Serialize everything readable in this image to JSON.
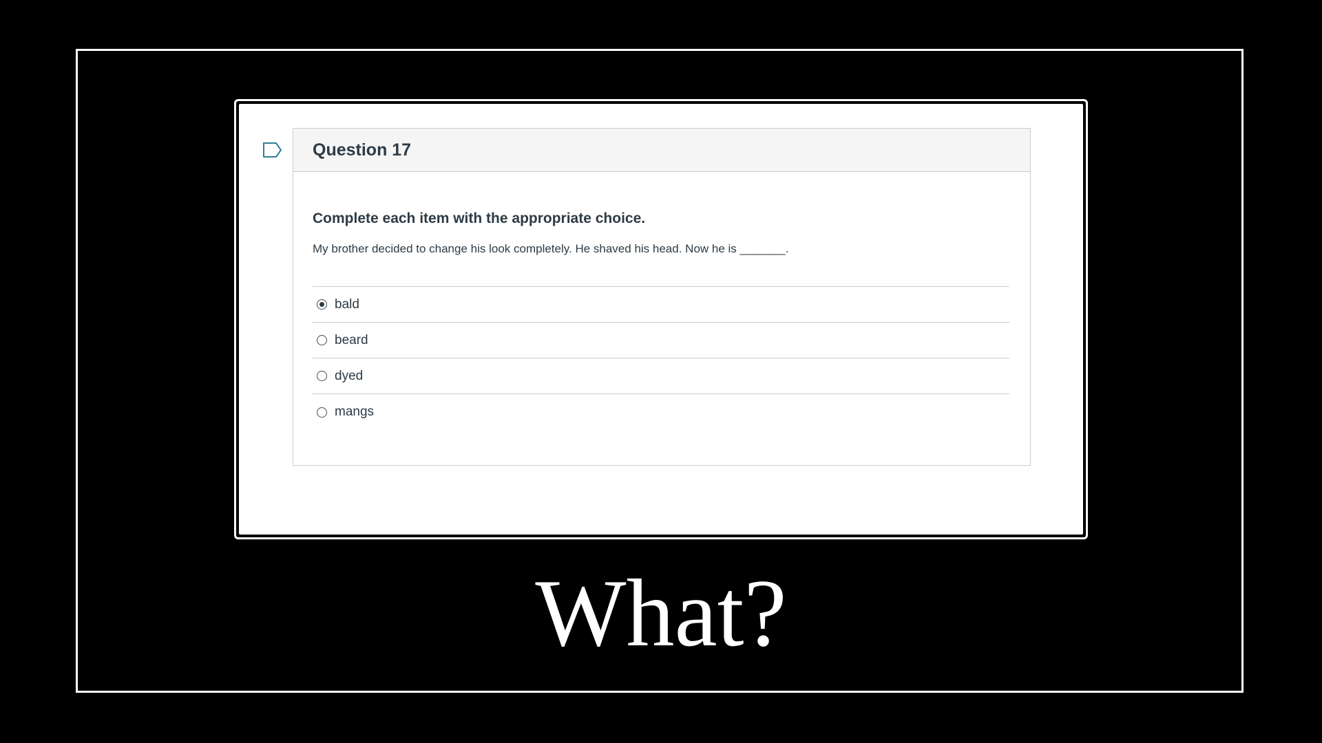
{
  "question": {
    "title": "Question 17",
    "instruction": "Complete each item with the appropriate choice.",
    "text": "My brother decided to change his look completely. He shaved his head. Now he is _______.",
    "answers": [
      {
        "label": "bald",
        "selected": true
      },
      {
        "label": "beard",
        "selected": false
      },
      {
        "label": "dyed",
        "selected": false
      },
      {
        "label": "mangs",
        "selected": false
      }
    ]
  },
  "caption": "What?",
  "colors": {
    "background": "#000000",
    "frame": "#ffffff",
    "text": "#2d3b45",
    "header_bg": "#f5f5f5",
    "border": "#c7cdd1",
    "flag": "#2d7f9a"
  },
  "icons": {
    "flag": "flag-outline-icon"
  }
}
